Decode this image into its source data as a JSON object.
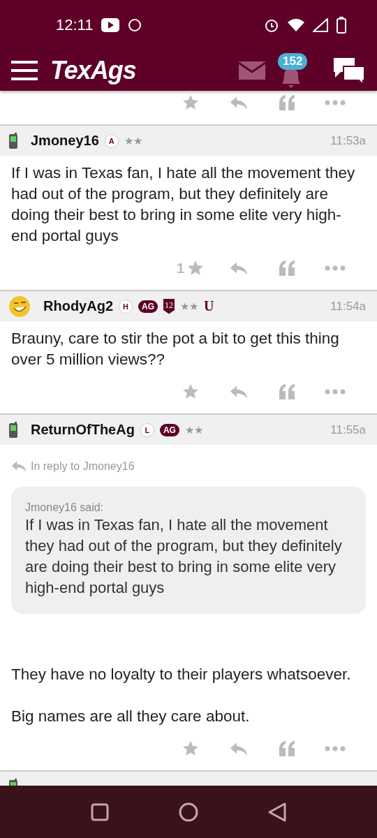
{
  "status_bar": {
    "time": "12:11"
  },
  "app_bar": {
    "logo": "TexAgs",
    "notification_count": "152"
  },
  "posts": [
    {
      "avatar": {
        "kind": "phone"
      },
      "name": "Jmoney16",
      "badges": [
        {
          "kind": "circle",
          "text": "A"
        },
        {
          "kind": "stars",
          "text": "★★"
        }
      ],
      "time": "11:53a",
      "paragraphs": [
        "If I was in Texas fan, I hate all the movement they had out of the program, but they definitely are doing their best to bring in some elite very high-end portal guys"
      ],
      "like_count": "1"
    },
    {
      "avatar": {
        "kind": "emoji"
      },
      "name": "RhodyAg2",
      "badges": [
        {
          "kind": "circle",
          "text": "H"
        },
        {
          "kind": "pill",
          "text": "AG"
        },
        {
          "kind": "shield",
          "text": "12"
        },
        {
          "kind": "stars",
          "text": "★★"
        },
        {
          "kind": "logo",
          "text": "U"
        }
      ],
      "time": "11:54a",
      "paragraphs": [
        "Brauny, care to stir the pot a bit to get this thing over 5 million views??"
      ]
    },
    {
      "avatar": {
        "kind": "phone"
      },
      "name": "ReturnOfTheAg",
      "badges": [
        {
          "kind": "circle",
          "text": "L"
        },
        {
          "kind": "pill",
          "text": "AG"
        },
        {
          "kind": "stars",
          "text": "★★"
        }
      ],
      "time": "11:55a",
      "reply_to": "In reply to Jmoney16",
      "quote": {
        "said": "Jmoney16 said:",
        "text": "If I was in Texas fan, I hate all the movement they had out of the program, but they definitely are doing their best to bring in some elite very high-end portal guys"
      },
      "paragraphs": [
        "They have no loyalty to their players whatsoever.",
        "Big names are all they care about."
      ]
    }
  ],
  "partial_post": {
    "avatar": {
      "kind": "phone"
    }
  }
}
